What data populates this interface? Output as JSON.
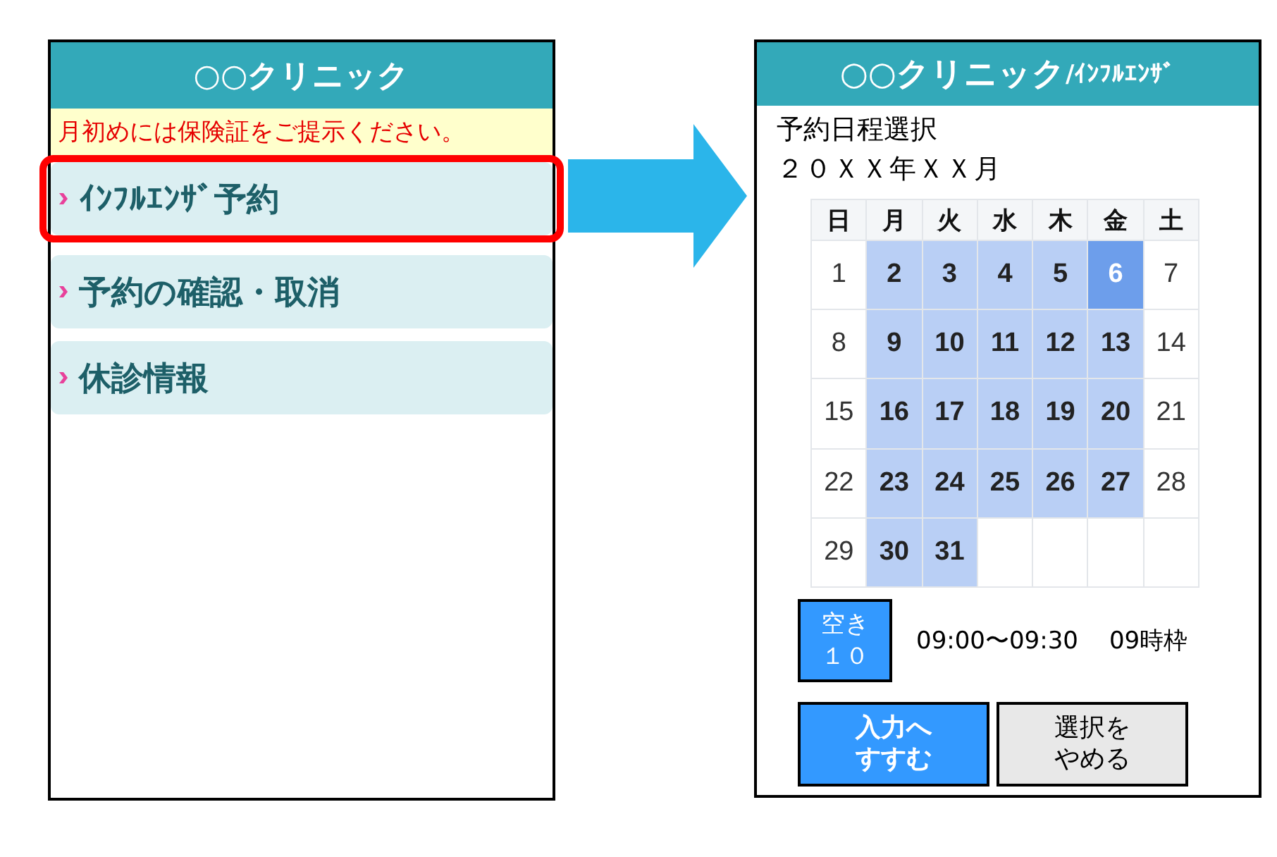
{
  "left_screen": {
    "header": "○○クリニック",
    "notice": "月初めには保険証をご提示ください。",
    "menu": [
      {
        "label": "ｲﾝﾌﾙｴﾝｻﾞ予約",
        "highlighted": true
      },
      {
        "label": "予約の確認・取消",
        "highlighted": false
      },
      {
        "label": "休診情報",
        "highlighted": false
      }
    ]
  },
  "right_screen": {
    "header": {
      "clinic": "○○クリニック",
      "suffix": "/ｲﾝﾌﾙｴﾝｻﾞ"
    },
    "title": "予約日程選択",
    "month": "２０ＸＸ年ＸＸ月",
    "calendar": {
      "weekdays": [
        "日",
        "月",
        "火",
        "水",
        "木",
        "金",
        "土"
      ],
      "weeks": [
        [
          {
            "day": "1",
            "available": false,
            "selected": false
          },
          {
            "day": "2",
            "available": true,
            "selected": false
          },
          {
            "day": "3",
            "available": true,
            "selected": false
          },
          {
            "day": "4",
            "available": true,
            "selected": false
          },
          {
            "day": "5",
            "available": true,
            "selected": false
          },
          {
            "day": "6",
            "available": true,
            "selected": true
          },
          {
            "day": "7",
            "available": false,
            "selected": false
          }
        ],
        [
          {
            "day": "8",
            "available": false,
            "selected": false
          },
          {
            "day": "9",
            "available": true,
            "selected": false
          },
          {
            "day": "10",
            "available": true,
            "selected": false
          },
          {
            "day": "11",
            "available": true,
            "selected": false
          },
          {
            "day": "12",
            "available": true,
            "selected": false
          },
          {
            "day": "13",
            "available": true,
            "selected": false
          },
          {
            "day": "14",
            "available": false,
            "selected": false
          }
        ],
        [
          {
            "day": "15",
            "available": false,
            "selected": false
          },
          {
            "day": "16",
            "available": true,
            "selected": false
          },
          {
            "day": "17",
            "available": true,
            "selected": false
          },
          {
            "day": "18",
            "available": true,
            "selected": false
          },
          {
            "day": "19",
            "available": true,
            "selected": false
          },
          {
            "day": "20",
            "available": true,
            "selected": false
          },
          {
            "day": "21",
            "available": false,
            "selected": false
          }
        ],
        [
          {
            "day": "22",
            "available": false,
            "selected": false
          },
          {
            "day": "23",
            "available": true,
            "selected": false
          },
          {
            "day": "24",
            "available": true,
            "selected": false
          },
          {
            "day": "25",
            "available": true,
            "selected": false
          },
          {
            "day": "26",
            "available": true,
            "selected": false
          },
          {
            "day": "27",
            "available": true,
            "selected": false
          },
          {
            "day": "28",
            "available": false,
            "selected": false
          }
        ],
        [
          {
            "day": "29",
            "available": false,
            "selected": false
          },
          {
            "day": "30",
            "available": true,
            "selected": false
          },
          {
            "day": "31",
            "available": true,
            "selected": false
          }
        ]
      ]
    },
    "slot": {
      "badge_lines": [
        "空き",
        "１０"
      ],
      "time": "09:00〜09:30",
      "frame": "09時枠"
    },
    "buttons": [
      {
        "kind": "primary",
        "lines": [
          "入力へ",
          "すすむ"
        ]
      },
      {
        "kind": "secondary",
        "lines": [
          "選択を",
          "やめる"
        ]
      }
    ]
  }
}
